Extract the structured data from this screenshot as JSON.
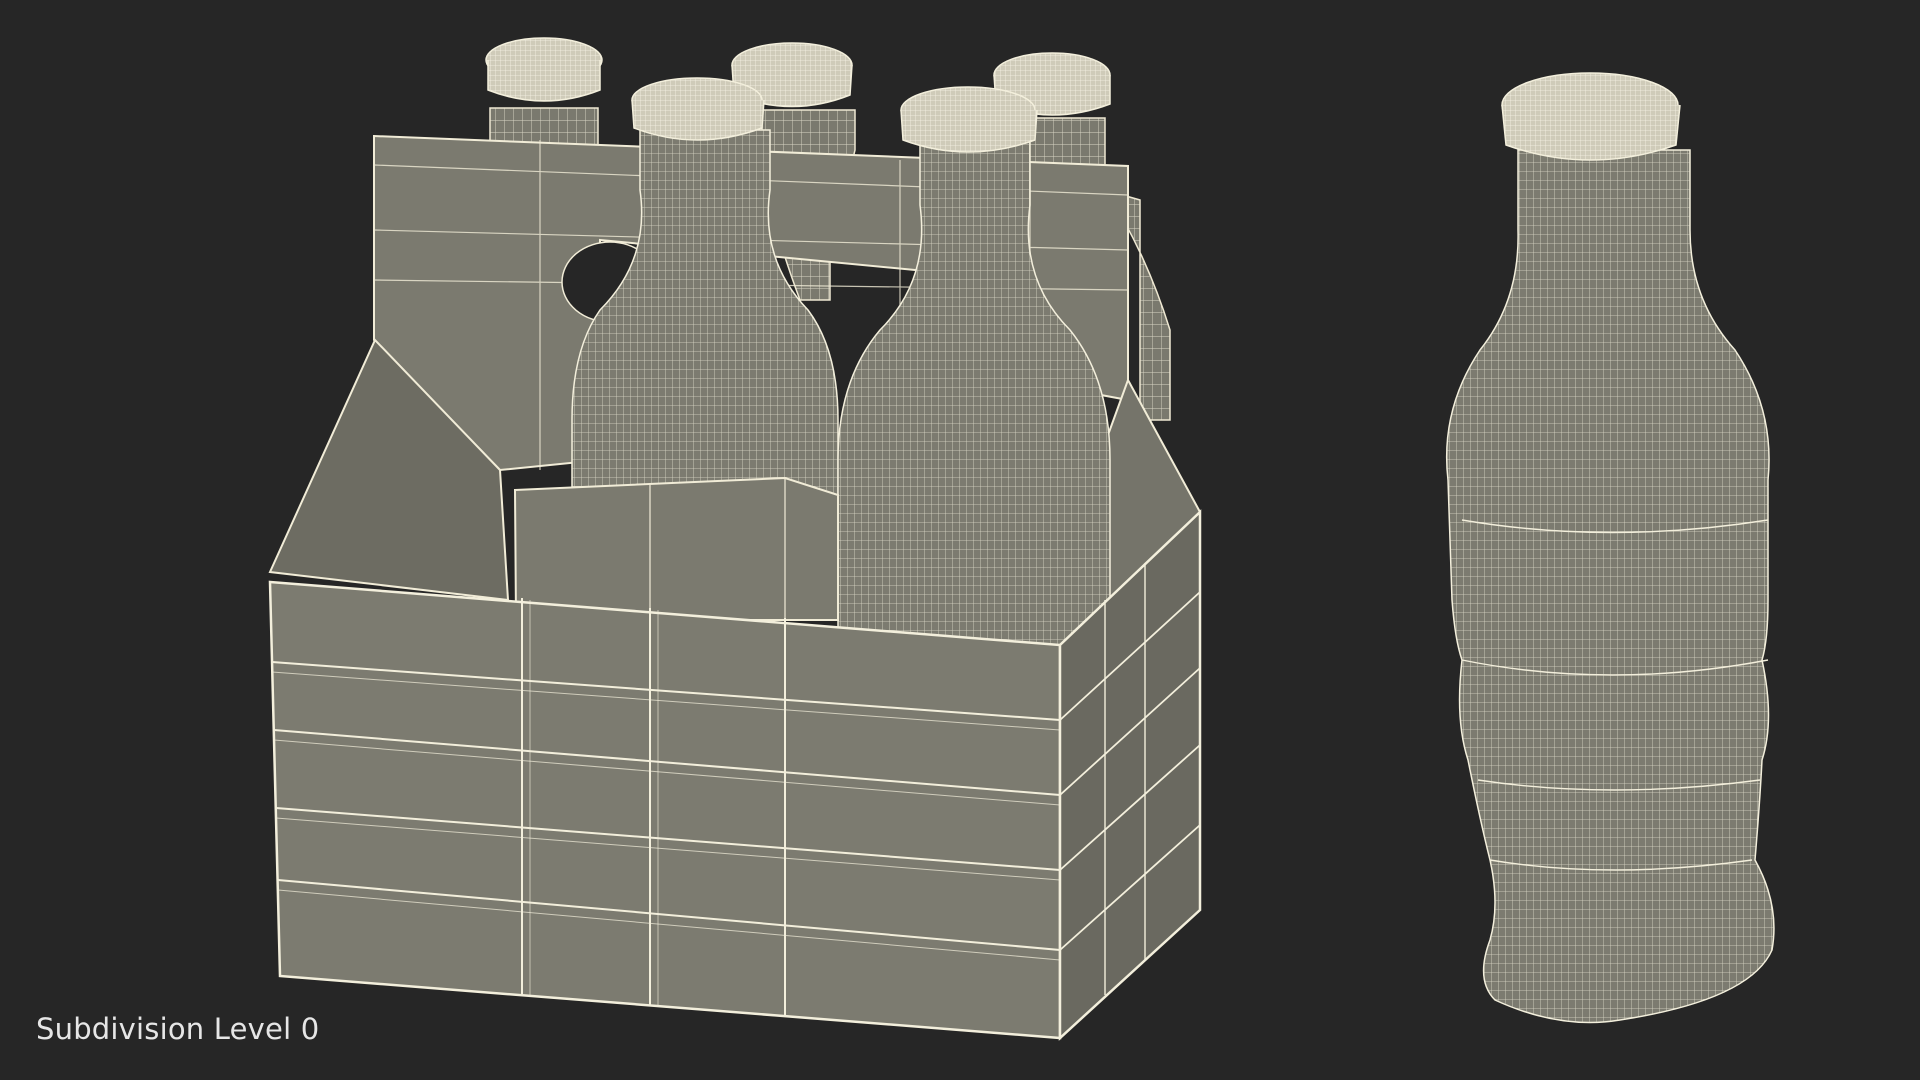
{
  "caption": "Subdivision Level 0",
  "colors": {
    "background": "#262626",
    "surface": "#7b7a6f",
    "surface_dark": "#5f5e55",
    "wire": "#f4f1df",
    "caption": "#e6e6e6"
  },
  "scene": {
    "objects": [
      "six-pack-carrier",
      "glass-bottle"
    ]
  }
}
